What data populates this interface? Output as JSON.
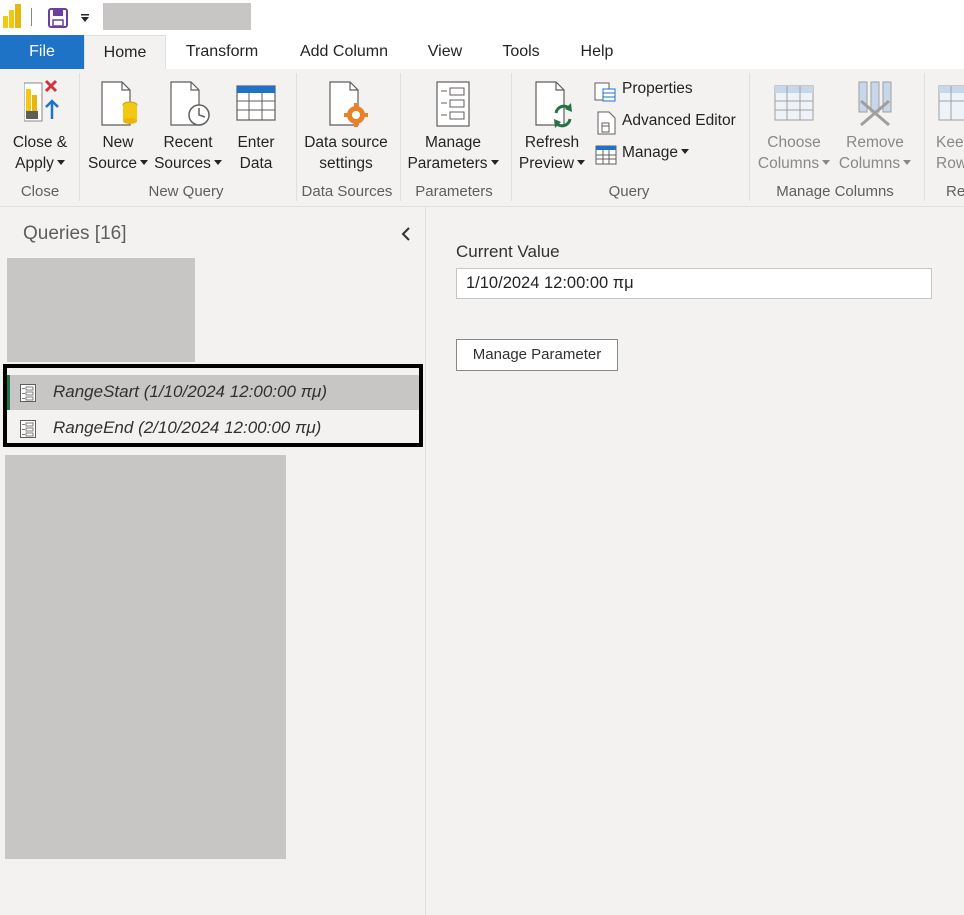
{
  "quick_access": {
    "logo_icon": "power-bi-logo-icon",
    "save_icon": "save-icon",
    "customize_icon": "chevron-down-icon"
  },
  "tabs": [
    {
      "label": "File"
    },
    {
      "label": "Home"
    },
    {
      "label": "Transform"
    },
    {
      "label": "Add Column"
    },
    {
      "label": "View"
    },
    {
      "label": "Tools"
    },
    {
      "label": "Help"
    }
  ],
  "ribbon": {
    "close_group": {
      "label": "Close",
      "close_apply": {
        "line1": "Close &",
        "line2": "Apply"
      }
    },
    "new_query_group": {
      "label": "New Query",
      "new_source": {
        "line1": "New",
        "line2": "Source"
      },
      "recent_sources": {
        "line1": "Recent",
        "line2": "Sources"
      },
      "enter_data": {
        "line1": "Enter",
        "line2": "Data"
      }
    },
    "data_sources_group": {
      "label": "Data Sources",
      "data_source_settings": {
        "line1": "Data source",
        "line2": "settings"
      }
    },
    "parameters_group": {
      "label": "Parameters",
      "manage_parameters": {
        "line1": "Manage",
        "line2": "Parameters"
      }
    },
    "query_group": {
      "label": "Query",
      "refresh_preview": {
        "line1": "Refresh",
        "line2": "Preview"
      },
      "properties": "Properties",
      "advanced_editor": "Advanced Editor",
      "manage": "Manage"
    },
    "manage_columns_group": {
      "label": "Manage Columns",
      "choose_columns": {
        "line1": "Choose",
        "line2": "Columns"
      },
      "remove_columns": {
        "line1": "Remove",
        "line2": "Columns"
      }
    },
    "reduce_rows_group": {
      "label": "Re",
      "keep_rows": {
        "line1": "Kee",
        "line2": "Row"
      }
    }
  },
  "queries_pane": {
    "title": "Queries [16]",
    "items": [
      {
        "label": "RangeStart (1/10/2024 12:00:00 πμ)",
        "selected": true
      },
      {
        "label": "RangeEnd (2/10/2024 12:00:00 πμ)",
        "selected": false
      }
    ]
  },
  "main": {
    "current_value_label": "Current Value",
    "current_value": "1/10/2024 12:00:00 πμ",
    "manage_parameter_button": "Manage Parameter"
  },
  "colors": {
    "file_tab": "#1f73c6",
    "selected_accent": "#217346",
    "ribbon_bg": "#f3f2f1"
  }
}
